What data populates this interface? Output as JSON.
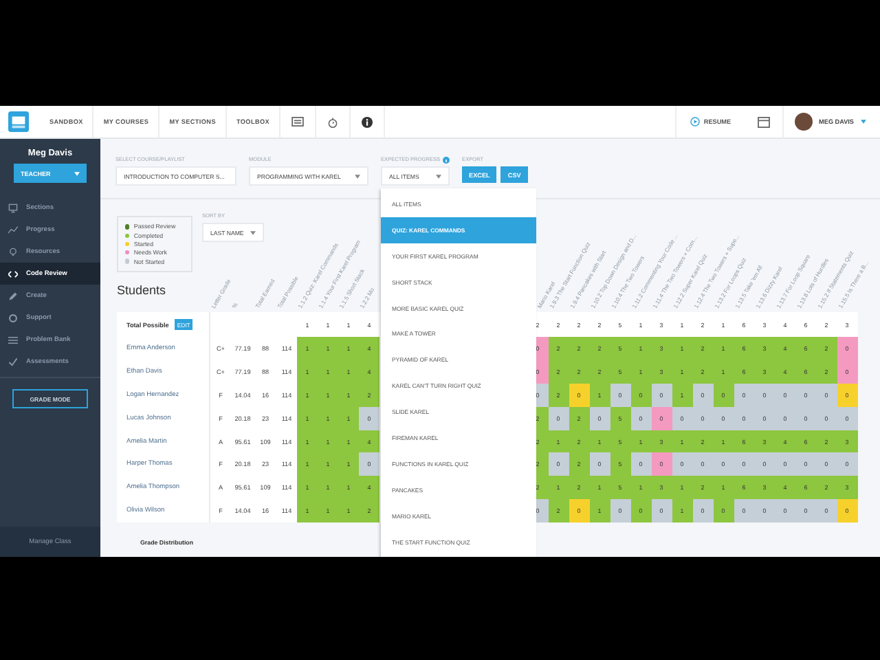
{
  "nav": {
    "items": [
      "SANDBOX",
      "MY COURSES",
      "MY SECTIONS",
      "TOOLBOX"
    ],
    "resume": "RESUME",
    "user": "MEG DAVIS"
  },
  "sidebar": {
    "user": "Meg Davis",
    "role": "TEACHER",
    "items": [
      {
        "label": "Sections",
        "kind": "monitor",
        "selected": false
      },
      {
        "label": "Progress",
        "kind": "chart",
        "selected": false
      },
      {
        "label": "Resources",
        "kind": "bulb",
        "selected": false
      },
      {
        "label": "Code Review",
        "kind": "code",
        "selected": true
      },
      {
        "label": "Create",
        "kind": "pencil",
        "selected": false
      },
      {
        "label": "Support",
        "kind": "ring",
        "selected": false
      },
      {
        "label": "Problem Bank",
        "kind": "list",
        "selected": false
      },
      {
        "label": "Assessments",
        "kind": "check",
        "selected": false
      }
    ],
    "grade_mode": "GRADE MODE",
    "footer": "Manage Class"
  },
  "filters": [
    {
      "label": "SELECT COURSE/PLAYLIST",
      "value": "INTRODUCTION TO COMPUTER S...",
      "info": false
    },
    {
      "label": "MODULE",
      "value": "PROGRAMMING WITH KAREL",
      "info": false
    },
    {
      "label": "EXPECTED PROGRESS",
      "value": "ALL ITEMS",
      "info": true
    }
  ],
  "export": {
    "label": "EXPORT",
    "buttons": [
      "EXCEL",
      "CSV"
    ]
  },
  "legend": [
    {
      "label": "Passed Review",
      "color": "#4f7f2a"
    },
    {
      "label": "Completed",
      "color": "#8dc63f"
    },
    {
      "label": "Started",
      "color": "#f5d020"
    },
    {
      "label": "Needs Work",
      "color": "#f08cc0"
    },
    {
      "label": "Not Started",
      "color": "#c3ccd5"
    }
  ],
  "sort": {
    "label": "SORT BY",
    "value": "LAST NAME"
  },
  "heading": "Students",
  "table": {
    "stat_columns": [
      "Letter Grade",
      "%",
      "Total Earned",
      "Total Possible"
    ],
    "total_label": "Total Possible",
    "edit": "EDIT",
    "left_columns": [
      {
        "label": "1.1.2 Quiz: Karel Commands",
        "possible": "1"
      },
      {
        "label": "1.1.4 Your First Karel Program",
        "possible": "1"
      },
      {
        "label": "1.1.5 Short Stack",
        "possible": "1"
      },
      {
        "label": "1.2.2 Mo",
        "possible": "4"
      }
    ],
    "right_columns": [
      {
        "label": "Mario Karel",
        "possible": "2"
      },
      {
        "label": "1.9.3 The Start Function Quiz",
        "possible": "2"
      },
      {
        "label": "1.9.4 Pancakes with Start",
        "possible": "2"
      },
      {
        "label": "1.10.2 Top Down Design and D...",
        "possible": "2"
      },
      {
        "label": "1.10.4 The Two Towers",
        "possible": "5"
      },
      {
        "label": "1.11.2 Commenting Your Code ...",
        "possible": "1"
      },
      {
        "label": "1.11.4 The Two Towers + Com...",
        "possible": "3"
      },
      {
        "label": "1.12.2 Super Karel Quiz",
        "possible": "1"
      },
      {
        "label": "1.12.4 The Two Towers + Supe...",
        "possible": "2"
      },
      {
        "label": "1.13.2 For Loops Quiz",
        "possible": "1"
      },
      {
        "label": "1.13.5 Take 'em All",
        "possible": "6"
      },
      {
        "label": "1.13.6 Dizzy Karel",
        "possible": "3"
      },
      {
        "label": "1.13.7 For Loop Square",
        "possible": "4"
      },
      {
        "label": "1.13.8 Lots of Hurdles",
        "possible": "6"
      },
      {
        "label": "1.15.2 If Statements Quiz",
        "possible": "2"
      },
      {
        "label": "1.15.5 Is There a B...",
        "possible": "3"
      }
    ],
    "rows": [
      {
        "name": "Emma Anderson",
        "letter": "C+",
        "percent": "77.19",
        "earned": "88",
        "possible": "114",
        "left": [
          {
            "value": "1",
            "color": "#8dc63f"
          },
          {
            "value": "1",
            "color": "#8dc63f"
          },
          {
            "value": "1",
            "color": "#8dc63f"
          },
          {
            "value": "4",
            "color": "#8dc63f"
          }
        ],
        "right": [
          {
            "value": "0",
            "color": "#f49ac1"
          },
          {
            "value": "2",
            "color": "#8dc63f"
          },
          {
            "value": "2",
            "color": "#8dc63f"
          },
          {
            "value": "2",
            "color": "#8dc63f"
          },
          {
            "value": "5",
            "color": "#8dc63f"
          },
          {
            "value": "1",
            "color": "#8dc63f"
          },
          {
            "value": "3",
            "color": "#8dc63f"
          },
          {
            "value": "1",
            "color": "#8dc63f"
          },
          {
            "value": "2",
            "color": "#8dc63f"
          },
          {
            "value": "1",
            "color": "#8dc63f"
          },
          {
            "value": "6",
            "color": "#8dc63f"
          },
          {
            "value": "3",
            "color": "#8dc63f"
          },
          {
            "value": "4",
            "color": "#8dc63f"
          },
          {
            "value": "6",
            "color": "#8dc63f"
          },
          {
            "value": "2",
            "color": "#8dc63f"
          },
          {
            "value": "0",
            "color": "#f49ac1"
          }
        ]
      },
      {
        "name": "Ethan Davis",
        "letter": "C+",
        "percent": "77.19",
        "earned": "88",
        "possible": "114",
        "left": [
          {
            "value": "1",
            "color": "#8dc63f"
          },
          {
            "value": "1",
            "color": "#8dc63f"
          },
          {
            "value": "1",
            "color": "#8dc63f"
          },
          {
            "value": "4",
            "color": "#8dc63f"
          }
        ],
        "right": [
          {
            "value": "0",
            "color": "#f49ac1"
          },
          {
            "value": "2",
            "color": "#8dc63f"
          },
          {
            "value": "2",
            "color": "#8dc63f"
          },
          {
            "value": "2",
            "color": "#8dc63f"
          },
          {
            "value": "5",
            "color": "#8dc63f"
          },
          {
            "value": "1",
            "color": "#8dc63f"
          },
          {
            "value": "3",
            "color": "#8dc63f"
          },
          {
            "value": "1",
            "color": "#8dc63f"
          },
          {
            "value": "2",
            "color": "#8dc63f"
          },
          {
            "value": "1",
            "color": "#8dc63f"
          },
          {
            "value": "6",
            "color": "#8dc63f"
          },
          {
            "value": "3",
            "color": "#8dc63f"
          },
          {
            "value": "4",
            "color": "#8dc63f"
          },
          {
            "value": "6",
            "color": "#8dc63f"
          },
          {
            "value": "2",
            "color": "#8dc63f"
          },
          {
            "value": "0",
            "color": "#f49ac1"
          }
        ]
      },
      {
        "name": "Logan Hernandez",
        "letter": "F",
        "percent": "14.04",
        "earned": "16",
        "possible": "114",
        "left": [
          {
            "value": "1",
            "color": "#8dc63f"
          },
          {
            "value": "1",
            "color": "#8dc63f"
          },
          {
            "value": "1",
            "color": "#8dc63f"
          },
          {
            "value": "2",
            "color": "#8dc63f"
          }
        ],
        "right": [
          {
            "value": "0",
            "color": "#c5cfd8"
          },
          {
            "value": "2",
            "color": "#8dc63f"
          },
          {
            "value": "0",
            "color": "#f7d12b"
          },
          {
            "value": "1",
            "color": "#8dc63f"
          },
          {
            "value": "0",
            "color": "#c5cfd8"
          },
          {
            "value": "0",
            "color": "#8dc63f"
          },
          {
            "value": "0",
            "color": "#c5cfd8"
          },
          {
            "value": "1",
            "color": "#8dc63f"
          },
          {
            "value": "0",
            "color": "#c5cfd8"
          },
          {
            "value": "0",
            "color": "#8dc63f"
          },
          {
            "value": "0",
            "color": "#c5cfd8"
          },
          {
            "value": "0",
            "color": "#c5cfd8"
          },
          {
            "value": "0",
            "color": "#c5cfd8"
          },
          {
            "value": "0",
            "color": "#c5cfd8"
          },
          {
            "value": "0",
            "color": "#c5cfd8"
          },
          {
            "value": "0",
            "color": "#f7d12b"
          }
        ]
      },
      {
        "name": "Lucas Johnson",
        "letter": "F",
        "percent": "20.18",
        "earned": "23",
        "possible": "114",
        "left": [
          {
            "value": "1",
            "color": "#8dc63f"
          },
          {
            "value": "1",
            "color": "#8dc63f"
          },
          {
            "value": "1",
            "color": "#8dc63f"
          },
          {
            "value": "0",
            "color": "#c5cfd8"
          }
        ],
        "right": [
          {
            "value": "2",
            "color": "#8dc63f"
          },
          {
            "value": "0",
            "color": "#c5cfd8"
          },
          {
            "value": "2",
            "color": "#8dc63f"
          },
          {
            "value": "0",
            "color": "#c5cfd8"
          },
          {
            "value": "5",
            "color": "#8dc63f"
          },
          {
            "value": "0",
            "color": "#c5cfd8"
          },
          {
            "value": "0",
            "color": "#f49ac1"
          },
          {
            "value": "0",
            "color": "#c5cfd8"
          },
          {
            "value": "0",
            "color": "#c5cfd8"
          },
          {
            "value": "0",
            "color": "#c5cfd8"
          },
          {
            "value": "0",
            "color": "#c5cfd8"
          },
          {
            "value": "0",
            "color": "#c5cfd8"
          },
          {
            "value": "0",
            "color": "#c5cfd8"
          },
          {
            "value": "0",
            "color": "#c5cfd8"
          },
          {
            "value": "0",
            "color": "#c5cfd8"
          },
          {
            "value": "0",
            "color": "#c5cfd8"
          }
        ]
      },
      {
        "name": "Amelia Martin",
        "letter": "A",
        "percent": "95.61",
        "earned": "109",
        "possible": "114",
        "left": [
          {
            "value": "1",
            "color": "#8dc63f"
          },
          {
            "value": "1",
            "color": "#8dc63f"
          },
          {
            "value": "1",
            "color": "#8dc63f"
          },
          {
            "value": "4",
            "color": "#8dc63f"
          }
        ],
        "right": [
          {
            "value": "2",
            "color": "#8dc63f"
          },
          {
            "value": "1",
            "color": "#8dc63f"
          },
          {
            "value": "2",
            "color": "#8dc63f"
          },
          {
            "value": "1",
            "color": "#8dc63f"
          },
          {
            "value": "5",
            "color": "#8dc63f"
          },
          {
            "value": "1",
            "color": "#8dc63f"
          },
          {
            "value": "3",
            "color": "#8dc63f"
          },
          {
            "value": "1",
            "color": "#8dc63f"
          },
          {
            "value": "2",
            "color": "#8dc63f"
          },
          {
            "value": "1",
            "color": "#8dc63f"
          },
          {
            "value": "6",
            "color": "#8dc63f"
          },
          {
            "value": "3",
            "color": "#8dc63f"
          },
          {
            "value": "4",
            "color": "#8dc63f"
          },
          {
            "value": "6",
            "color": "#8dc63f"
          },
          {
            "value": "2",
            "color": "#8dc63f"
          },
          {
            "value": "3",
            "color": "#8dc63f"
          }
        ]
      },
      {
        "name": "Harper Thomas",
        "letter": "F",
        "percent": "20.18",
        "earned": "23",
        "possible": "114",
        "left": [
          {
            "value": "1",
            "color": "#8dc63f"
          },
          {
            "value": "1",
            "color": "#8dc63f"
          },
          {
            "value": "1",
            "color": "#8dc63f"
          },
          {
            "value": "0",
            "color": "#c5cfd8"
          }
        ],
        "right": [
          {
            "value": "2",
            "color": "#8dc63f"
          },
          {
            "value": "0",
            "color": "#c5cfd8"
          },
          {
            "value": "2",
            "color": "#8dc63f"
          },
          {
            "value": "0",
            "color": "#c5cfd8"
          },
          {
            "value": "5",
            "color": "#8dc63f"
          },
          {
            "value": "0",
            "color": "#c5cfd8"
          },
          {
            "value": "0",
            "color": "#f49ac1"
          },
          {
            "value": "0",
            "color": "#c5cfd8"
          },
          {
            "value": "0",
            "color": "#c5cfd8"
          },
          {
            "value": "0",
            "color": "#c5cfd8"
          },
          {
            "value": "0",
            "color": "#c5cfd8"
          },
          {
            "value": "0",
            "color": "#c5cfd8"
          },
          {
            "value": "0",
            "color": "#c5cfd8"
          },
          {
            "value": "0",
            "color": "#c5cfd8"
          },
          {
            "value": "0",
            "color": "#c5cfd8"
          },
          {
            "value": "0",
            "color": "#c5cfd8"
          }
        ]
      },
      {
        "name": "Amelia Thompson",
        "letter": "A",
        "percent": "95.61",
        "earned": "109",
        "possible": "114",
        "left": [
          {
            "value": "1",
            "color": "#8dc63f"
          },
          {
            "value": "1",
            "color": "#8dc63f"
          },
          {
            "value": "1",
            "color": "#8dc63f"
          },
          {
            "value": "4",
            "color": "#8dc63f"
          }
        ],
        "right": [
          {
            "value": "2",
            "color": "#8dc63f"
          },
          {
            "value": "1",
            "color": "#8dc63f"
          },
          {
            "value": "2",
            "color": "#8dc63f"
          },
          {
            "value": "1",
            "color": "#8dc63f"
          },
          {
            "value": "5",
            "color": "#8dc63f"
          },
          {
            "value": "1",
            "color": "#8dc63f"
          },
          {
            "value": "3",
            "color": "#8dc63f"
          },
          {
            "value": "1",
            "color": "#8dc63f"
          },
          {
            "value": "2",
            "color": "#8dc63f"
          },
          {
            "value": "1",
            "color": "#8dc63f"
          },
          {
            "value": "6",
            "color": "#8dc63f"
          },
          {
            "value": "3",
            "color": "#8dc63f"
          },
          {
            "value": "4",
            "color": "#8dc63f"
          },
          {
            "value": "6",
            "color": "#8dc63f"
          },
          {
            "value": "2",
            "color": "#8dc63f"
          },
          {
            "value": "3",
            "color": "#8dc63f"
          }
        ]
      },
      {
        "name": "Olivia Wilson",
        "letter": "F",
        "percent": "14.04",
        "earned": "16",
        "possible": "114",
        "left": [
          {
            "value": "1",
            "color": "#8dc63f"
          },
          {
            "value": "1",
            "color": "#8dc63f"
          },
          {
            "value": "1",
            "color": "#8dc63f"
          },
          {
            "value": "2",
            "color": "#8dc63f"
          }
        ],
        "right": [
          {
            "value": "0",
            "color": "#c5cfd8"
          },
          {
            "value": "2",
            "color": "#8dc63f"
          },
          {
            "value": "0",
            "color": "#f7d12b"
          },
          {
            "value": "1",
            "color": "#8dc63f"
          },
          {
            "value": "0",
            "color": "#c5cfd8"
          },
          {
            "value": "0",
            "color": "#8dc63f"
          },
          {
            "value": "0",
            "color": "#c5cfd8"
          },
          {
            "value": "1",
            "color": "#8dc63f"
          },
          {
            "value": "0",
            "color": "#c5cfd8"
          },
          {
            "value": "0",
            "color": "#8dc63f"
          },
          {
            "value": "0",
            "color": "#c5cfd8"
          },
          {
            "value": "0",
            "color": "#c5cfd8"
          },
          {
            "value": "0",
            "color": "#c5cfd8"
          },
          {
            "value": "0",
            "color": "#c5cfd8"
          },
          {
            "value": "0",
            "color": "#c5cfd8"
          },
          {
            "value": "0",
            "color": "#f7d12b"
          }
        ]
      }
    ]
  },
  "dropdown": {
    "items": [
      {
        "label": "ALL ITEMS",
        "selected": false
      },
      {
        "label": "QUIZ: KAREL COMMANDS",
        "selected": true
      },
      {
        "label": "YOUR FIRST KAREL PROGRAM",
        "selected": false
      },
      {
        "label": "SHORT STACK",
        "selected": false
      },
      {
        "label": "MORE BASIC KAREL QUIZ",
        "selected": false
      },
      {
        "label": "MAKE A TOWER",
        "selected": false
      },
      {
        "label": "PYRAMID OF KAREL",
        "selected": false
      },
      {
        "label": "KAREL CAN'T TURN RIGHT QUIZ",
        "selected": false
      },
      {
        "label": "SLIDE KAREL",
        "selected": false
      },
      {
        "label": "FIREMAN KAREL",
        "selected": false
      },
      {
        "label": "FUNCTIONS IN KAREL QUIZ",
        "selected": false
      },
      {
        "label": "PANCAKES",
        "selected": false
      },
      {
        "label": "MARIO KAREL",
        "selected": false
      },
      {
        "label": "THE START FUNCTION QUIZ",
        "selected": false
      }
    ]
  },
  "grade_distribution": "Grade Distribution"
}
